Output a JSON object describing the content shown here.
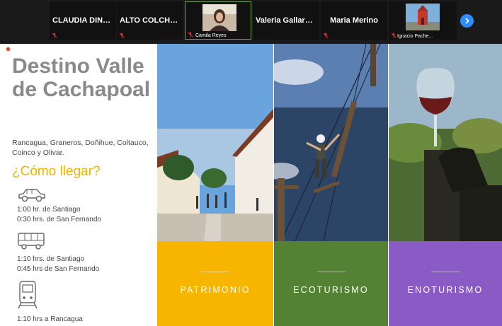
{
  "participants": [
    {
      "name": "CLAUDIA  DINA...",
      "muted": true
    },
    {
      "name": "ALTO  COLCHAG...",
      "muted": true
    },
    {
      "name": "Camila Reyes",
      "muted": true,
      "video": true
    },
    {
      "name": "Valeria  Gallardo...",
      "muted": false
    },
    {
      "name": "Maria Merino",
      "muted": true
    },
    {
      "name": "Ignacio Pache...",
      "muted": true,
      "video": true
    }
  ],
  "next_icon": "chevron-right-icon",
  "slide": {
    "title": "Destino Valle de Cachapoal",
    "towns": "Rancagua, Graneros, Doñihue, Coltauco, Coinco y Olivar.",
    "how_to_get": "¿Cómo llegar?",
    "routes": [
      {
        "icon": "car-icon",
        "lines": [
          "1:00 hr. de Santiago",
          "0:30 hrs. de San Fernando"
        ]
      },
      {
        "icon": "bus-icon",
        "lines": [
          "1:10 hrs. de Santiago",
          "0:45 hrs de San Fernando"
        ]
      },
      {
        "icon": "train-icon",
        "lines": [
          "1:10 hrs a Rancagua"
        ]
      }
    ],
    "categories": [
      {
        "label": "PATRIMONIO",
        "color": "#f7b500"
      },
      {
        "label": "ECOTURISMO",
        "color": "#548234"
      },
      {
        "label": "ENOTURISMO",
        "color": "#8a5bc4"
      }
    ]
  }
}
